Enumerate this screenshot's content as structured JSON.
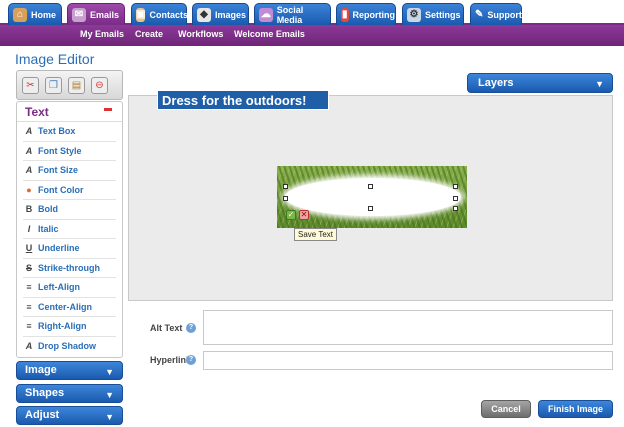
{
  "nav": {
    "tabs": [
      {
        "label": "Home",
        "icon": "home-icon"
      },
      {
        "label": "Emails",
        "icon": "emails-icon",
        "active": true
      },
      {
        "label": "Contacts",
        "icon": "contacts-icon"
      },
      {
        "label": "Images",
        "icon": "images-icon"
      },
      {
        "label": "Social Media",
        "icon": "social-media-icon"
      },
      {
        "label": "Reporting",
        "icon": "reporting-icon"
      },
      {
        "label": "Settings",
        "icon": "settings-icon"
      },
      {
        "label": "Support",
        "icon": "support-icon"
      }
    ],
    "subnav": [
      "My Emails",
      "Create",
      "Workflows",
      "Welcome Emails"
    ]
  },
  "page": {
    "title": "Image Editor"
  },
  "layers": {
    "label": "Layers"
  },
  "sidebar": {
    "tools": [
      "cut-icon",
      "copy-icon",
      "paste-icon",
      "delete-icon"
    ],
    "text_panel": {
      "title": "Text",
      "items": [
        {
          "label": "Text Box",
          "icon": "text-box-icon"
        },
        {
          "label": "Font Style",
          "icon": "font-style-icon"
        },
        {
          "label": "Font Size",
          "icon": "font-size-icon"
        },
        {
          "label": "Font Color",
          "icon": "font-color-icon"
        },
        {
          "label": "Bold",
          "icon": "bold-icon"
        },
        {
          "label": "Italic",
          "icon": "italic-icon"
        },
        {
          "label": "Underline",
          "icon": "underline-icon"
        },
        {
          "label": "Strike-through",
          "icon": "strikethrough-icon"
        },
        {
          "label": "Left-Align",
          "icon": "left-align-icon"
        },
        {
          "label": "Center-Align",
          "icon": "center-align-icon"
        },
        {
          "label": "Right-Align",
          "icon": "right-align-icon"
        },
        {
          "label": "Drop Shadow",
          "icon": "drop-shadow-icon"
        }
      ]
    },
    "sections": [
      "Image",
      "Shapes",
      "Adjust"
    ]
  },
  "canvas": {
    "text_content": "Dress for the outdoors!",
    "tooltip": "Save Text"
  },
  "fields": {
    "alt_text_label": "Alt Text",
    "hyperlink_label": "Hyperlink"
  },
  "buttons": {
    "cancel": "Cancel",
    "finish": "Finish Image"
  },
  "colors": {
    "brand_purple": "#7a2c87",
    "accent_blue": "#1a5aae"
  }
}
